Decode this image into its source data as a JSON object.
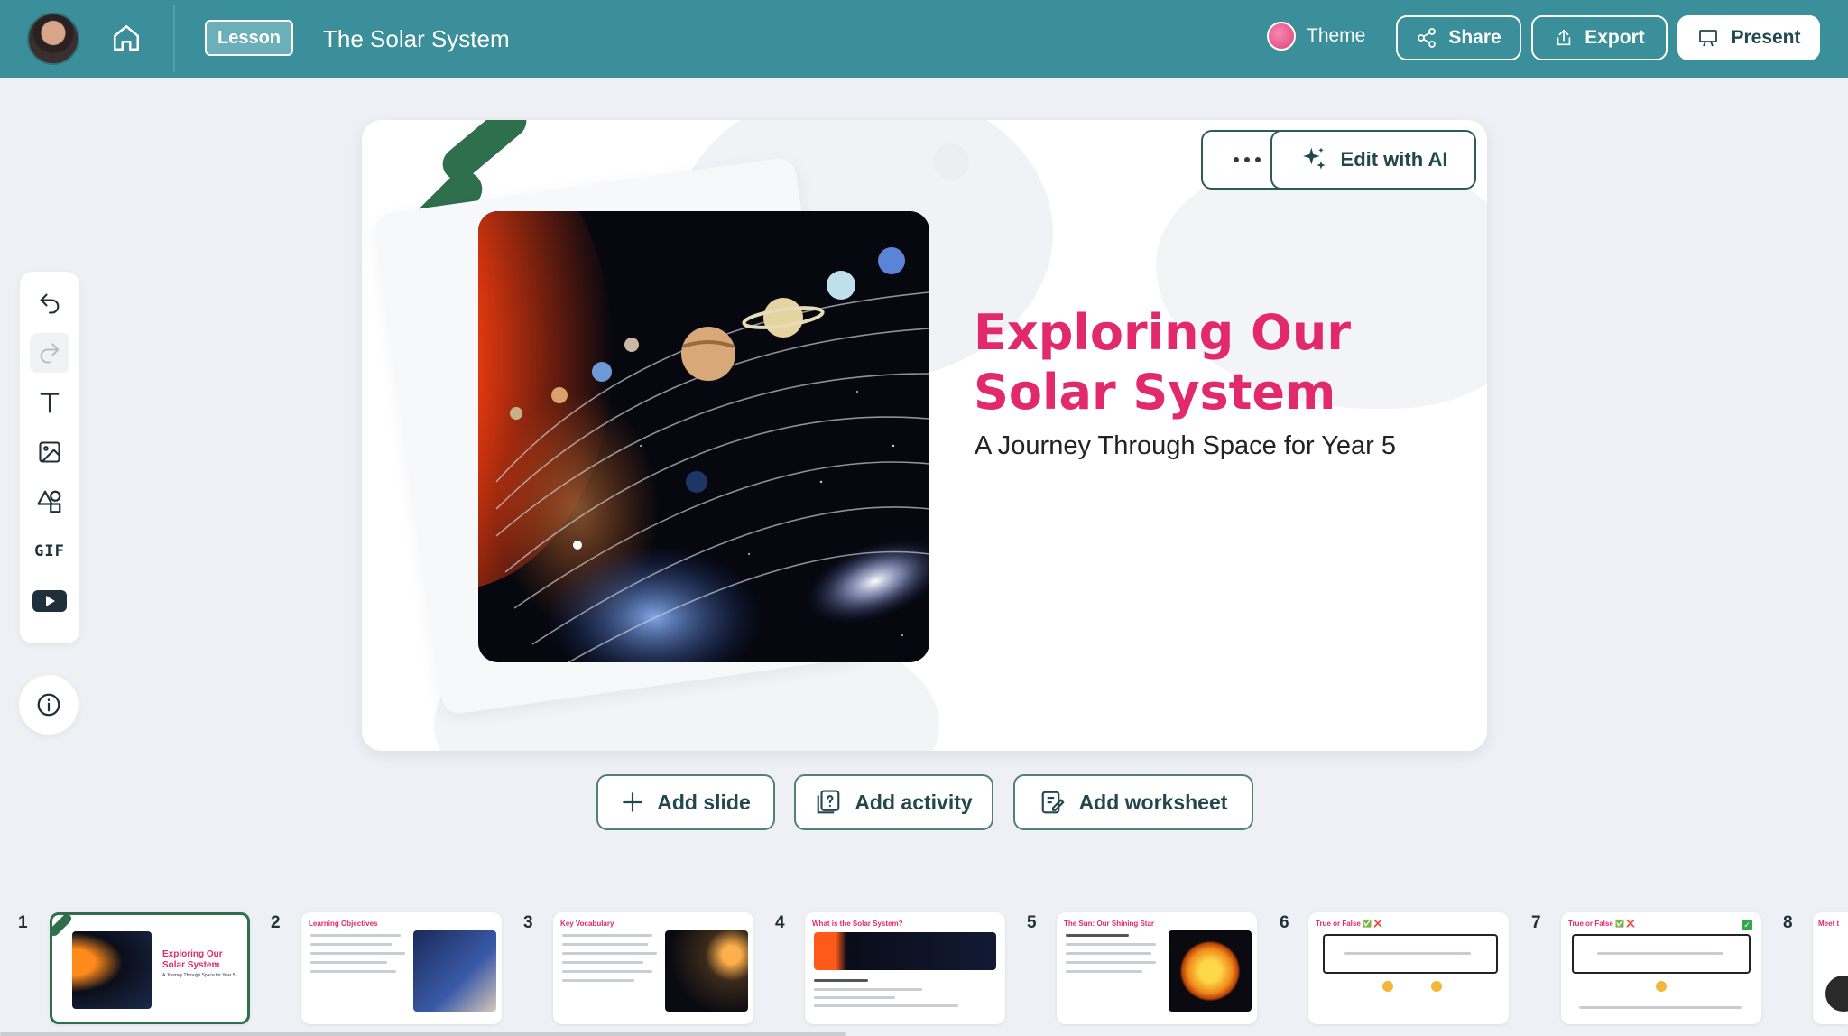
{
  "header": {
    "lesson_badge": "Lesson",
    "title": "The Solar System",
    "theme_label": "Theme",
    "share_label": "Share",
    "export_label": "Export",
    "present_label": "Present"
  },
  "slide": {
    "title": "Exploring Our Solar System",
    "subtitle": "A Journey Through Space for Year 5",
    "edit_ai_label": "Edit with AI"
  },
  "toolbar": {
    "gif_label": "GIF"
  },
  "actions": {
    "add_slide": "Add slide",
    "add_activity": "Add activity",
    "add_worksheet": "Add worksheet"
  },
  "thumbnails": [
    {
      "num": "1",
      "title": "Exploring Our Solar System",
      "subtitle": "A Journey Through Space for Year 5"
    },
    {
      "num": "2",
      "title": "Learning Objectives"
    },
    {
      "num": "3",
      "title": "Key Vocabulary"
    },
    {
      "num": "4",
      "title": "What is the Solar System?"
    },
    {
      "num": "5",
      "title": "The Sun: Our Shining Star"
    },
    {
      "num": "6",
      "title": "True or False ✅ ❌"
    },
    {
      "num": "7",
      "title": "True or False ✅ ❌"
    },
    {
      "num": "8",
      "title": "Meet t"
    }
  ],
  "colors": {
    "header_bg": "#3a8f9a",
    "accent_pink": "#e2296b",
    "accent_green": "#2e6f4e"
  }
}
